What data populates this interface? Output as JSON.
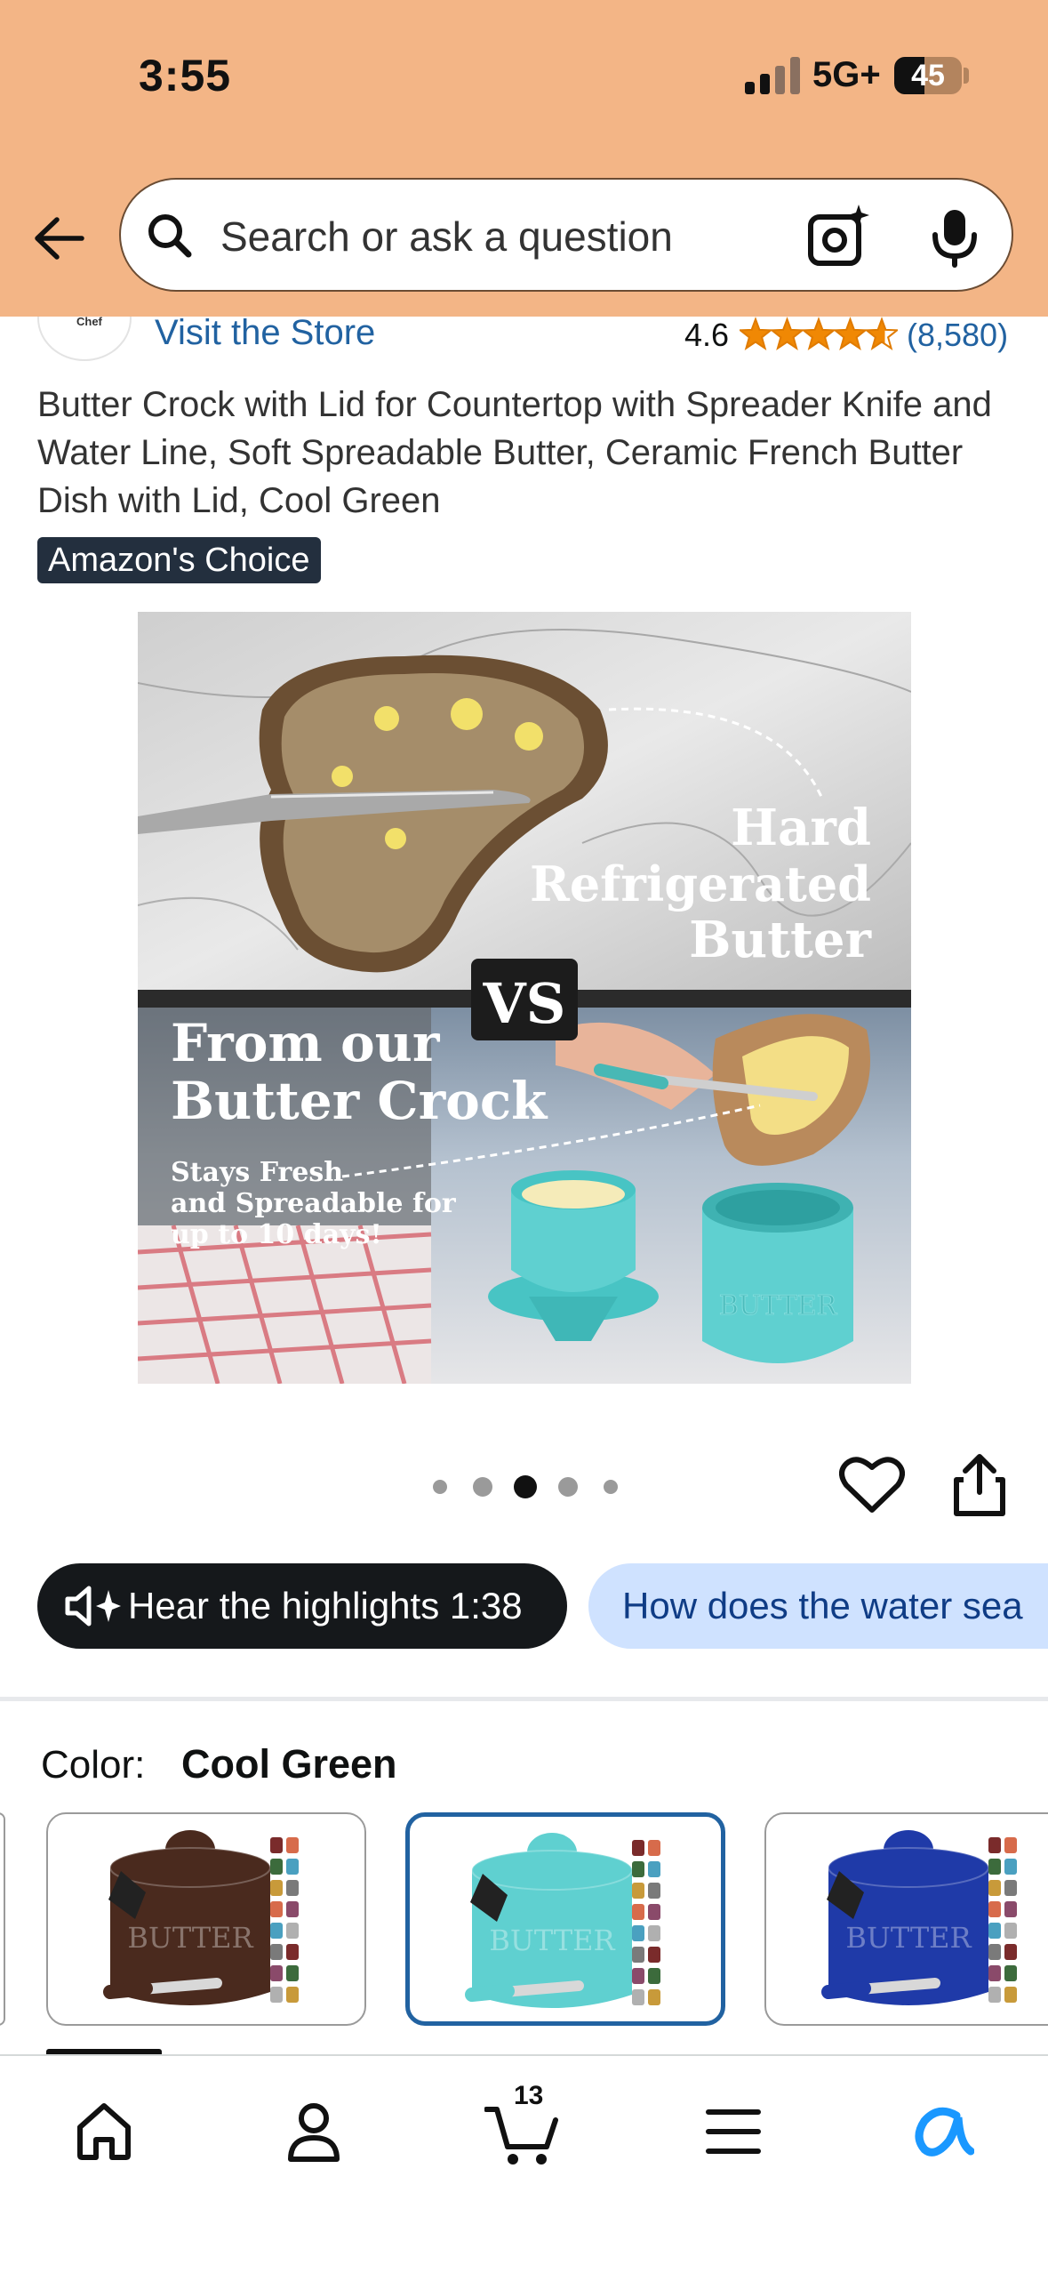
{
  "status_bar": {
    "time": "3:55",
    "network": "5G+",
    "battery_level": "45",
    "battery_fraction": 0.45
  },
  "header": {
    "search_placeholder": "Search or ask a question",
    "background_color": "#f3b586"
  },
  "brand": {
    "logo_text": "Chef",
    "visit_store": "Visit the Store",
    "rating": "4.6",
    "rating_value": 4.6,
    "rating_count": "(8,580)"
  },
  "product": {
    "title": "Butter Crock with Lid for Countertop with Spreader Knife and Water Line, Soft Spreadable Butter, Ceramic French Butter Dish with Lid, Cool Green",
    "badge": "Amazon's Choice",
    "image": {
      "top_caption_line1": "Hard",
      "top_caption_line2": "Refrigerated",
      "top_caption_line3": "Butter",
      "vs_label": "VS",
      "bottom_heading_line1": "From our",
      "bottom_heading_line2": "Butter Crock",
      "bottom_sub_line1": "Stays Fresh",
      "bottom_sub_line2": "and Spreadable for",
      "bottom_sub_line3": "up to 10 days!",
      "crock_text": "BUTTER"
    },
    "carousel": {
      "total": 5,
      "active_index": 2
    }
  },
  "actions": {
    "hear_highlights": "Hear the highlights 1:38",
    "question_chip": "How does the water sea"
  },
  "color_selector": {
    "label": "Color:",
    "value": "Cool Green",
    "swatch_text": "BUTTER",
    "swatches": [
      {
        "name": "Chocolate",
        "color": "#4a2a1e",
        "selected": false
      },
      {
        "name": "Cool Green",
        "color": "#5fd0d0",
        "selected": true
      },
      {
        "name": "Royal Blue",
        "color": "#1f3aa8",
        "selected": false
      }
    ]
  },
  "bottom_nav": {
    "cart_count": "13",
    "items": [
      "home-icon",
      "account-icon",
      "cart-icon",
      "menu-icon",
      "rufus-icon"
    ],
    "accent_color": "#1a98ff"
  }
}
